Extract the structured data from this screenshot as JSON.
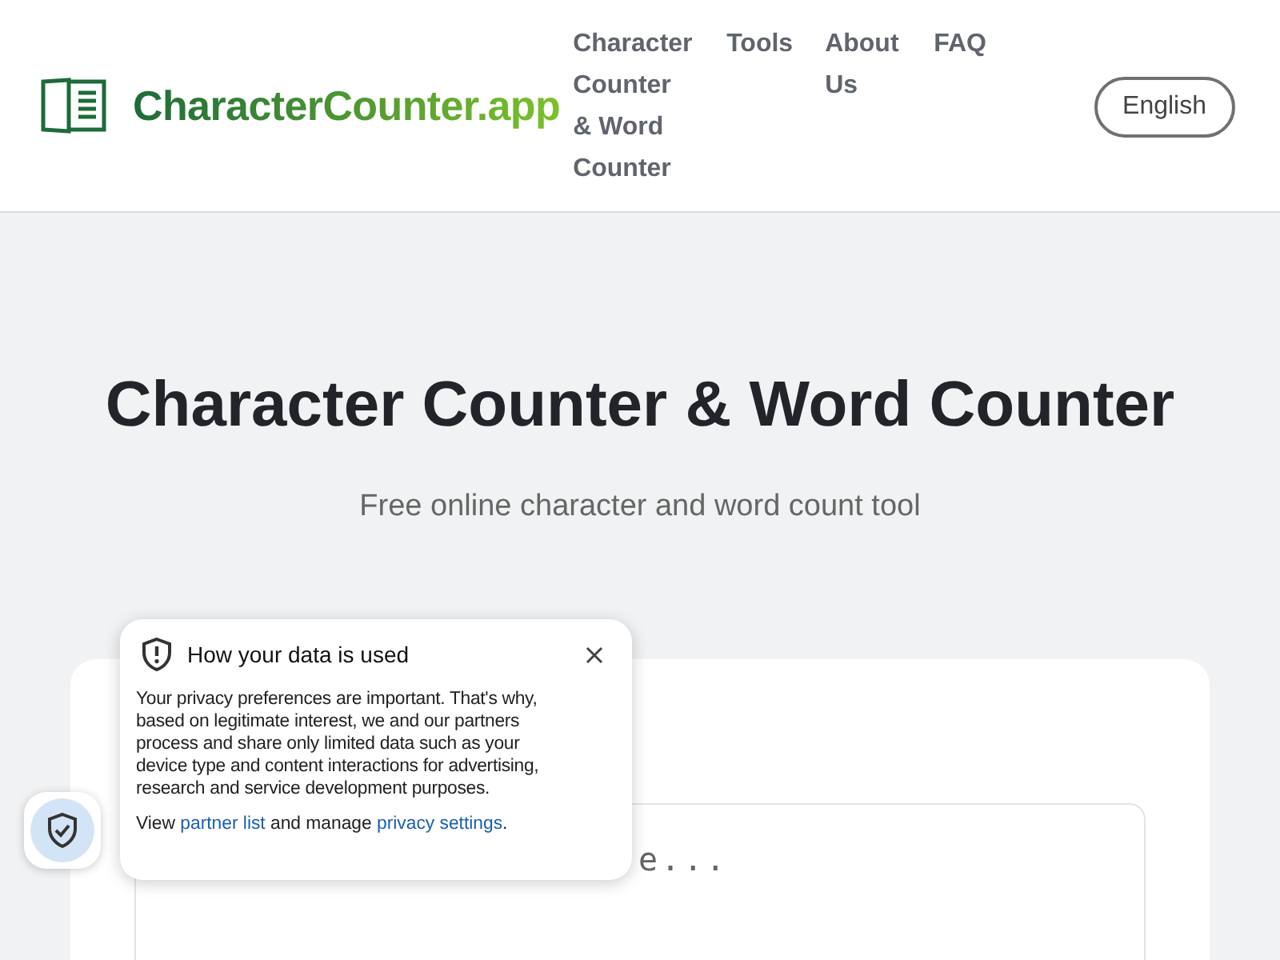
{
  "header": {
    "logo": "CharacterCounter.app",
    "nav": [
      {
        "label": "Character Counter & Word Counter"
      },
      {
        "label": "Tools"
      },
      {
        "label": "About Us"
      },
      {
        "label": "FAQ"
      }
    ],
    "language_button": "English"
  },
  "hero": {
    "title": "Character Counter & Word Counter",
    "subtitle": "Free online character and word count tool"
  },
  "editor": {
    "placeholder": "e..."
  },
  "privacy_popup": {
    "title": "How your data is used",
    "body": "Your privacy preferences are important. That's why, based on legitimate interest, we and our partners process and share only limited data such as your device type and content interactions for advertising, research and service development purposes.",
    "footer": [
      {
        "kind": "text",
        "text": "View "
      },
      {
        "kind": "link",
        "text": "partner list"
      },
      {
        "kind": "text",
        "text": " and manage "
      },
      {
        "kind": "link",
        "text": "privacy settings"
      },
      {
        "kind": "text",
        "text": "."
      }
    ]
  }
}
